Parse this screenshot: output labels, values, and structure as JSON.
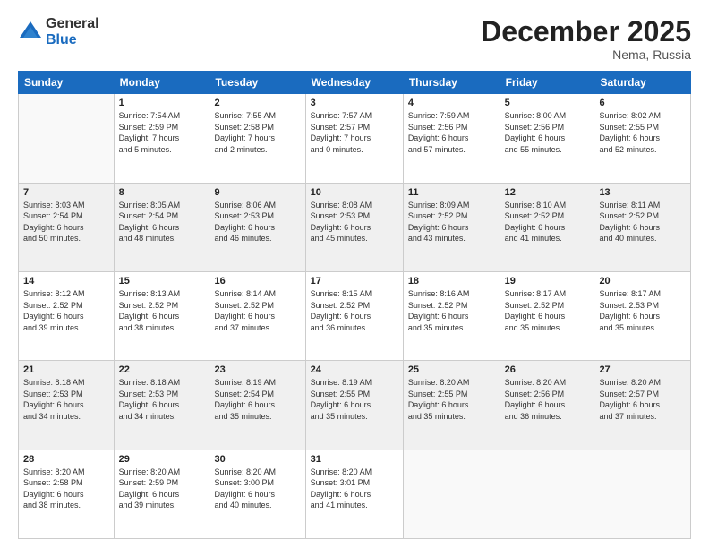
{
  "logo": {
    "general": "General",
    "blue": "Blue"
  },
  "title": "December 2025",
  "location": "Nema, Russia",
  "headers": [
    "Sunday",
    "Monday",
    "Tuesday",
    "Wednesday",
    "Thursday",
    "Friday",
    "Saturday"
  ],
  "weeks": [
    [
      {
        "day": "",
        "info": ""
      },
      {
        "day": "1",
        "info": "Sunrise: 7:54 AM\nSunset: 2:59 PM\nDaylight: 7 hours\nand 5 minutes."
      },
      {
        "day": "2",
        "info": "Sunrise: 7:55 AM\nSunset: 2:58 PM\nDaylight: 7 hours\nand 2 minutes."
      },
      {
        "day": "3",
        "info": "Sunrise: 7:57 AM\nSunset: 2:57 PM\nDaylight: 7 hours\nand 0 minutes."
      },
      {
        "day": "4",
        "info": "Sunrise: 7:59 AM\nSunset: 2:56 PM\nDaylight: 6 hours\nand 57 minutes."
      },
      {
        "day": "5",
        "info": "Sunrise: 8:00 AM\nSunset: 2:56 PM\nDaylight: 6 hours\nand 55 minutes."
      },
      {
        "day": "6",
        "info": "Sunrise: 8:02 AM\nSunset: 2:55 PM\nDaylight: 6 hours\nand 52 minutes."
      }
    ],
    [
      {
        "day": "7",
        "info": "Sunrise: 8:03 AM\nSunset: 2:54 PM\nDaylight: 6 hours\nand 50 minutes."
      },
      {
        "day": "8",
        "info": "Sunrise: 8:05 AM\nSunset: 2:54 PM\nDaylight: 6 hours\nand 48 minutes."
      },
      {
        "day": "9",
        "info": "Sunrise: 8:06 AM\nSunset: 2:53 PM\nDaylight: 6 hours\nand 46 minutes."
      },
      {
        "day": "10",
        "info": "Sunrise: 8:08 AM\nSunset: 2:53 PM\nDaylight: 6 hours\nand 45 minutes."
      },
      {
        "day": "11",
        "info": "Sunrise: 8:09 AM\nSunset: 2:52 PM\nDaylight: 6 hours\nand 43 minutes."
      },
      {
        "day": "12",
        "info": "Sunrise: 8:10 AM\nSunset: 2:52 PM\nDaylight: 6 hours\nand 41 minutes."
      },
      {
        "day": "13",
        "info": "Sunrise: 8:11 AM\nSunset: 2:52 PM\nDaylight: 6 hours\nand 40 minutes."
      }
    ],
    [
      {
        "day": "14",
        "info": "Sunrise: 8:12 AM\nSunset: 2:52 PM\nDaylight: 6 hours\nand 39 minutes."
      },
      {
        "day": "15",
        "info": "Sunrise: 8:13 AM\nSunset: 2:52 PM\nDaylight: 6 hours\nand 38 minutes."
      },
      {
        "day": "16",
        "info": "Sunrise: 8:14 AM\nSunset: 2:52 PM\nDaylight: 6 hours\nand 37 minutes."
      },
      {
        "day": "17",
        "info": "Sunrise: 8:15 AM\nSunset: 2:52 PM\nDaylight: 6 hours\nand 36 minutes."
      },
      {
        "day": "18",
        "info": "Sunrise: 8:16 AM\nSunset: 2:52 PM\nDaylight: 6 hours\nand 35 minutes."
      },
      {
        "day": "19",
        "info": "Sunrise: 8:17 AM\nSunset: 2:52 PM\nDaylight: 6 hours\nand 35 minutes."
      },
      {
        "day": "20",
        "info": "Sunrise: 8:17 AM\nSunset: 2:53 PM\nDaylight: 6 hours\nand 35 minutes."
      }
    ],
    [
      {
        "day": "21",
        "info": "Sunrise: 8:18 AM\nSunset: 2:53 PM\nDaylight: 6 hours\nand 34 minutes."
      },
      {
        "day": "22",
        "info": "Sunrise: 8:18 AM\nSunset: 2:53 PM\nDaylight: 6 hours\nand 34 minutes."
      },
      {
        "day": "23",
        "info": "Sunrise: 8:19 AM\nSunset: 2:54 PM\nDaylight: 6 hours\nand 35 minutes."
      },
      {
        "day": "24",
        "info": "Sunrise: 8:19 AM\nSunset: 2:55 PM\nDaylight: 6 hours\nand 35 minutes."
      },
      {
        "day": "25",
        "info": "Sunrise: 8:20 AM\nSunset: 2:55 PM\nDaylight: 6 hours\nand 35 minutes."
      },
      {
        "day": "26",
        "info": "Sunrise: 8:20 AM\nSunset: 2:56 PM\nDaylight: 6 hours\nand 36 minutes."
      },
      {
        "day": "27",
        "info": "Sunrise: 8:20 AM\nSunset: 2:57 PM\nDaylight: 6 hours\nand 37 minutes."
      }
    ],
    [
      {
        "day": "28",
        "info": "Sunrise: 8:20 AM\nSunset: 2:58 PM\nDaylight: 6 hours\nand 38 minutes."
      },
      {
        "day": "29",
        "info": "Sunrise: 8:20 AM\nSunset: 2:59 PM\nDaylight: 6 hours\nand 39 minutes."
      },
      {
        "day": "30",
        "info": "Sunrise: 8:20 AM\nSunset: 3:00 PM\nDaylight: 6 hours\nand 40 minutes."
      },
      {
        "day": "31",
        "info": "Sunrise: 8:20 AM\nSunset: 3:01 PM\nDaylight: 6 hours\nand 41 minutes."
      },
      {
        "day": "",
        "info": ""
      },
      {
        "day": "",
        "info": ""
      },
      {
        "day": "",
        "info": ""
      }
    ]
  ]
}
